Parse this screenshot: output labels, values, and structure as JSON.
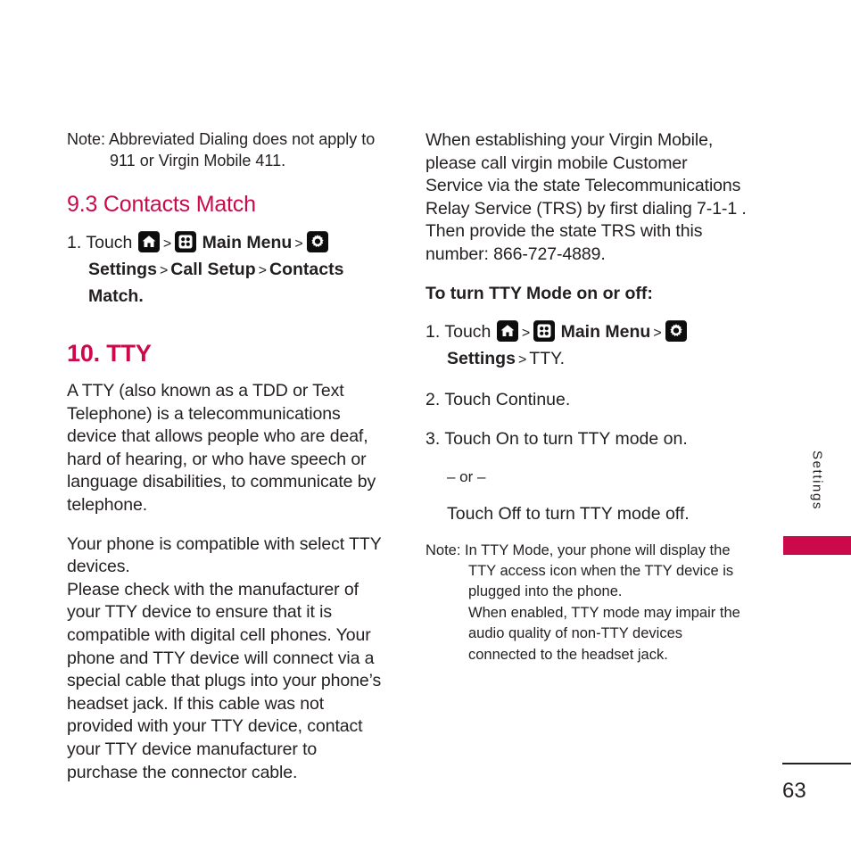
{
  "page": {
    "number": "63",
    "side_tab_label": "Settings",
    "accent_color": "#cc0a4b",
    "text_color": "#231f20"
  },
  "icons": {
    "home": "home-icon",
    "main_menu": "grid-menu-icon",
    "settings": "gear-icon"
  },
  "left_column": {
    "note_abbreviated": {
      "label": "Note:",
      "text": " Abbreviated Dialing does not apply to 911 or Virgin Mobile 411."
    },
    "heading_contacts_match": "9.3 Contacts Match",
    "step_contacts_match": {
      "number": "1.",
      "touch": "Touch",
      "sep1": ">",
      "main_menu": "Main Menu",
      "sep2": ">",
      "settings": "Settings",
      "sep3": ">",
      "call_setup": "Call Setup",
      "sep4": ">",
      "contacts_match": "Contacts Match."
    },
    "heading_tty": "10. TTY",
    "para_tty_definition": "A TTY (also known as a TDD or Text Telephone) is a telecommunications device that allows people who are deaf, hard of hearing, or who have speech or language disabilities, to communicate by telephone.",
    "para_compatible": "Your phone is compatible with select TTY devices.",
    "para_manufacturer": "Please check with the manufacturer of your TTY device to ensure that it is compatible with digital cell phones. Your phone and TTY device will connect via a special cable that plugs into your phone’s headset jack. If this cable was not provided with your TTY device, contact your TTY device manufacturer to purchase the connector cable."
  },
  "right_column": {
    "para_establishing": "When establishing your Virgin Mobile, please call virgin mobile Customer Service via the state Telecommunications Relay Service (TRS) by first dialing 7-1-1 . Then provide the state TRS with this number: 866-727-4889.",
    "heading_turn_tty": "To turn TTY Mode on or off:",
    "step1": {
      "number": "1.",
      "touch": "Touch",
      "sep1": ">",
      "main_menu": "Main Menu",
      "sep2": ">",
      "settings": "Settings",
      "sep3": ">",
      "tty": "TTY."
    },
    "step2": {
      "number": "2.",
      "text": "Touch Continue."
    },
    "step3": {
      "number": "3.",
      "text": "Touch On to turn TTY mode on."
    },
    "or_divider": "– or –",
    "touch_off": "Touch Off to turn TTY mode off.",
    "note_tty": {
      "label": "Note:",
      "line1": " In TTY Mode, your phone will display the TTY access icon when the TTY device is plugged into the phone.",
      "line2": "When enabled, TTY mode may impair the audio quality of non-TTY devices connected to the headset jack."
    }
  }
}
